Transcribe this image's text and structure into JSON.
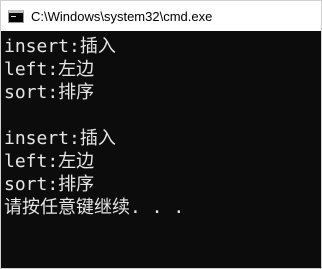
{
  "window": {
    "title": "C:\\Windows\\system32\\cmd.exe",
    "icon": "console-icon"
  },
  "console": {
    "lines": [
      "insert:插入",
      "left:左边",
      "sort:排序",
      "",
      "insert:插入",
      "left:左边",
      "sort:排序",
      "请按任意键继续. . ."
    ]
  }
}
